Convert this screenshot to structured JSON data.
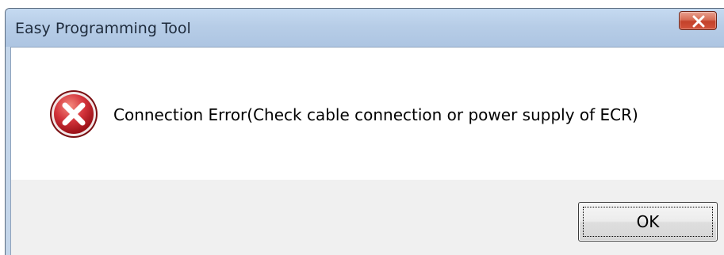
{
  "window": {
    "title": "Easy Programming Tool"
  },
  "titlebar": {
    "close_icon": "close-icon",
    "close_color": "#c84a33"
  },
  "dialog": {
    "icon": "error-icon",
    "icon_color": "#c4262e",
    "message": "Connection Error(Check cable connection or power supply of ECR)"
  },
  "buttons": {
    "ok_label": "OK"
  }
}
